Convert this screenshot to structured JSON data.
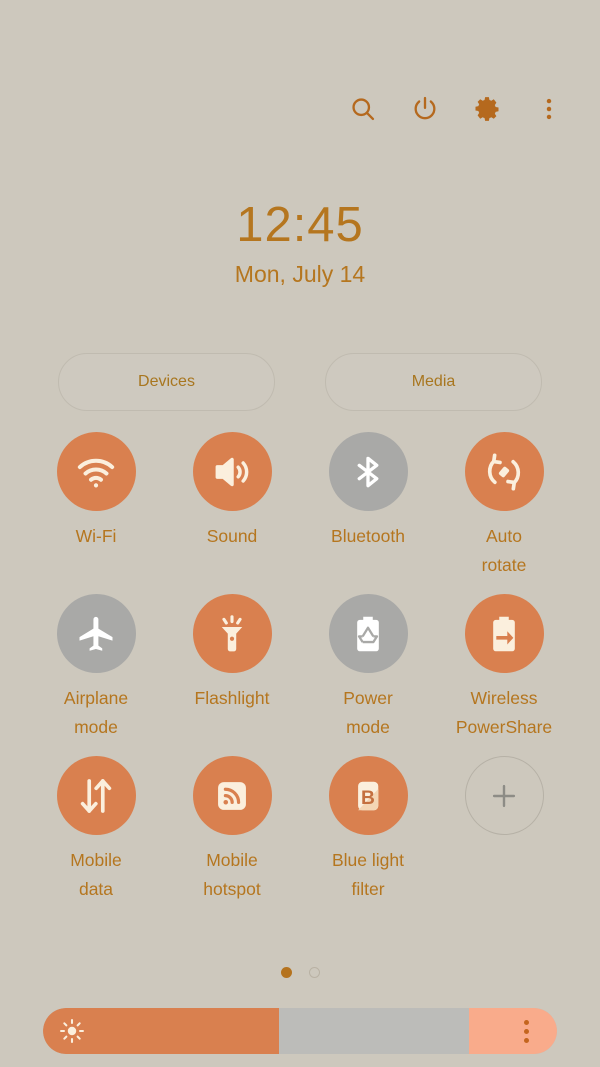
{
  "topbar": {
    "icons": [
      {
        "name": "search-icon",
        "label": "Search"
      },
      {
        "name": "power-icon",
        "label": "Power"
      },
      {
        "name": "settings-gear-icon",
        "label": "Settings"
      },
      {
        "name": "more-options-icon",
        "label": "More options"
      }
    ]
  },
  "status": {
    "time": "12:45",
    "date": "Mon, July 14"
  },
  "pills": [
    {
      "label": "Devices",
      "name": "devices-button"
    },
    {
      "label": "Media",
      "name": "media-button"
    }
  ],
  "toggles": [
    {
      "label": "Wi-Fi",
      "icon": "wifi-icon",
      "state": "on"
    },
    {
      "label": "Sound",
      "icon": "sound-icon",
      "state": "on"
    },
    {
      "label": "Bluetooth",
      "icon": "bluetooth-icon",
      "state": "off"
    },
    {
      "label": "Auto\nrotate",
      "icon": "auto-rotate-icon",
      "state": "on"
    },
    {
      "label": "Airplane\nmode",
      "icon": "airplane-icon",
      "state": "off"
    },
    {
      "label": "Flashlight",
      "icon": "flashlight-icon",
      "state": "on"
    },
    {
      "label": "Power\nmode",
      "icon": "power-mode-icon",
      "state": "off"
    },
    {
      "label": "Wireless\nPowerShare",
      "icon": "wireless-powershare-icon",
      "state": "on"
    },
    {
      "label": "Mobile\ndata",
      "icon": "mobile-data-icon",
      "state": "on"
    },
    {
      "label": "Mobile\nhotspot",
      "icon": "mobile-hotspot-icon",
      "state": "on"
    },
    {
      "label": "Blue light\nfilter",
      "icon": "blue-light-filter-icon",
      "state": "on"
    },
    {
      "label": "",
      "icon": "add-icon",
      "state": "add"
    }
  ],
  "pagination": {
    "total": 2,
    "current": 1
  },
  "brightness": {
    "icon": "brightness-sun-icon",
    "value_percent": 46,
    "expand_icon": "slider-more-options-icon"
  },
  "colors": {
    "background": "#cdc8bd",
    "accent_on": "#d9804f",
    "inactive": "#a9a9a7",
    "label_text": "#b5761f",
    "icon_fill": "#fbefdd",
    "slider_track": "#bcbcb9",
    "slider_expand": "#f9ab8b"
  }
}
